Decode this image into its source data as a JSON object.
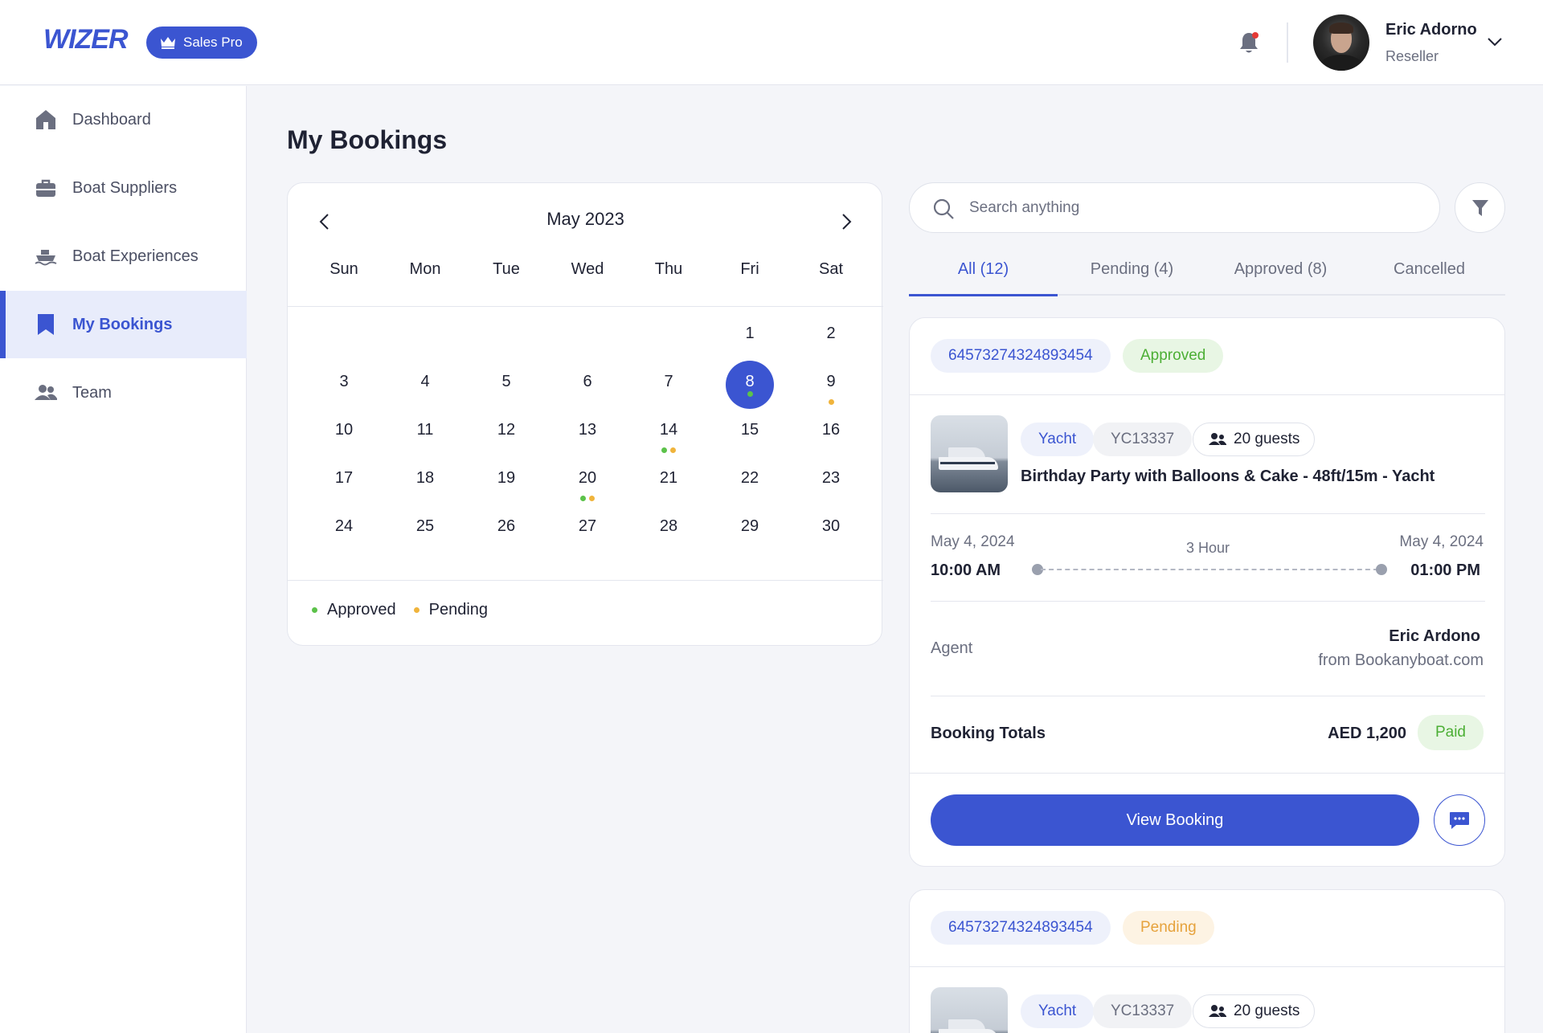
{
  "header": {
    "logo": "WIZER",
    "plan_badge": "Sales Pro",
    "user": {
      "name": "Eric Adorno",
      "role": "Reseller"
    }
  },
  "sidebar": {
    "items": [
      {
        "label": "Dashboard",
        "icon": "home-icon"
      },
      {
        "label": "Boat Suppliers",
        "icon": "briefcase-icon"
      },
      {
        "label": "Boat Experiences",
        "icon": "boat-icon"
      },
      {
        "label": "My Bookings",
        "icon": "bookmark-icon",
        "active": true
      },
      {
        "label": "Team",
        "icon": "team-icon"
      }
    ]
  },
  "page": {
    "title": "My Bookings"
  },
  "calendar": {
    "month_label": "May 2023",
    "weekdays": [
      "Sun",
      "Mon",
      "Tue",
      "Wed",
      "Thu",
      "Fri",
      "Sat"
    ],
    "weeks": [
      [
        "",
        "",
        "",
        "",
        "",
        "1",
        "2"
      ],
      [
        "3",
        "4",
        "5",
        "6",
        "7",
        "8",
        "9"
      ],
      [
        "10",
        "11",
        "12",
        "13",
        "14",
        "15",
        "16"
      ],
      [
        "17",
        "18",
        "19",
        "20",
        "21",
        "22",
        "23"
      ],
      [
        "24",
        "25",
        "26",
        "27",
        "28",
        "29",
        "30"
      ]
    ],
    "selected_day": "8",
    "markers": {
      "8": [
        "approved"
      ],
      "9": [
        "pending"
      ],
      "14": [
        "approved",
        "pending"
      ],
      "20": [
        "approved",
        "pending"
      ]
    },
    "legend": [
      {
        "label": "Approved",
        "status": "approved"
      },
      {
        "label": "Pending",
        "status": "pending"
      }
    ]
  },
  "colors": {
    "accent": "#3b55d1",
    "approved": "#5cc24a",
    "pending": "#f0b43c",
    "notification": "#e53935"
  },
  "search": {
    "placeholder": "Search anything",
    "value": ""
  },
  "tabs": [
    {
      "label": "All (12)",
      "active": true
    },
    {
      "label": "Pending (4)"
    },
    {
      "label": "Approved (8)"
    },
    {
      "label": "Cancelled"
    }
  ],
  "bookings": [
    {
      "id": "64573274324893454",
      "status": "Approved",
      "boat_type": "Yacht",
      "boat_code": "YC13337",
      "guests": "20 guests",
      "title": "Birthday Party with Balloons & Cake - 48ft/15m - Yacht",
      "start_date": "May 4, 2024",
      "start_time": "10:00 AM",
      "duration": "3 Hour",
      "end_date": "May 4, 2024",
      "end_time": "01:00 PM",
      "agent_label": "Agent",
      "agent_name": "Eric Ardono",
      "agent_source": "from Bookanyboat.com",
      "totals_label": "Booking Totals",
      "total": "AED 1,200",
      "payment_status": "Paid",
      "action_label": "View Booking"
    },
    {
      "id": "64573274324893454",
      "status": "Pending",
      "boat_type": "Yacht",
      "boat_code": "YC13337",
      "guests": "20 guests"
    }
  ]
}
